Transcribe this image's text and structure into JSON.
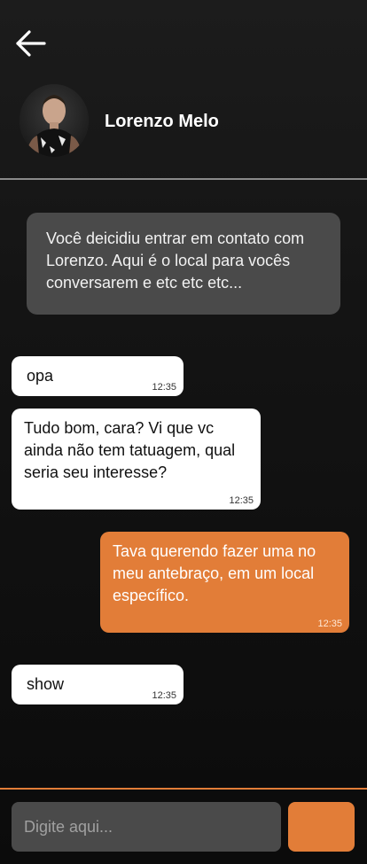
{
  "header": {
    "back_icon": "arrow-left-icon",
    "contact_name": "Lorenzo Melo"
  },
  "notice": {
    "text": "Você deicidiu entrar em contato com Lorenzo. Aqui é o local para vocês conversarem e etc etc etc..."
  },
  "messages": [
    {
      "direction": "incoming",
      "text": "opa",
      "time": "12:35"
    },
    {
      "direction": "incoming",
      "text": "Tudo bom, cara? Vi que vc ainda não tem tatuagem, qual seria seu interesse?",
      "time": "12:35"
    },
    {
      "direction": "outgoing",
      "text": "Tava querendo fazer uma no meu antebraço, em um local específico.",
      "time": "12:35"
    },
    {
      "direction": "incoming",
      "text": "show",
      "time": "12:35"
    }
  ],
  "composer": {
    "placeholder": "Digite aqui...",
    "value": ""
  },
  "colors": {
    "accent": "#e27d38",
    "incoming_bubble": "#ffffff",
    "notice_bubble": "#4a4a4a",
    "background": "#141414"
  }
}
